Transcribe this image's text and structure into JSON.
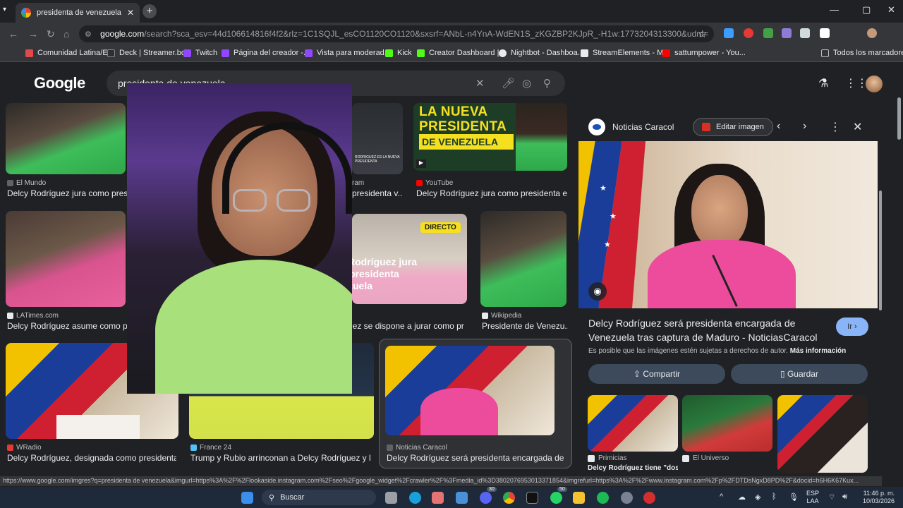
{
  "colors": {
    "accent": "#8ab4f8",
    "background": "#202124",
    "surface": "#303134",
    "text": "#e8eaed"
  },
  "browser": {
    "tab_title": "presidenta de venezuela - Busc",
    "address_host": "google.com",
    "address_rest": "/search?sca_esv=44d106614816f4f2&rlz=1C1SQJL_esCO1120CO1120&sxsrf=ANbL-n4YnA-WdEN1S_zKGZBP2KJpR_-H1w:1773204313300&udm=2&fbs=ADc_l-bpk8W...",
    "bookmarks": [
      {
        "label": "Comunidad Latina/E...",
        "color": "#e04a4a"
      },
      {
        "label": "Deck | Streamer.bot",
        "color": "#2c2f33"
      },
      {
        "label": "Twitch",
        "color": "#9146ff"
      },
      {
        "label": "Página del creador -...",
        "color": "#9146ff"
      },
      {
        "label": "Vista para moderad...",
        "color": "#9146ff"
      },
      {
        "label": "Kick",
        "color": "#53fc18"
      },
      {
        "label": "Creator Dashboard |...",
        "color": "#53fc18"
      },
      {
        "label": "Nightbot - Dashboa...",
        "color": "#e8eaed"
      },
      {
        "label": "StreamElements - M...",
        "color": "#e8eaed"
      },
      {
        "label": "satturnpower - You...",
        "color": "#ff0000"
      }
    ],
    "all_bookmarks": "Todos los marcadores"
  },
  "google": {
    "logo": "Google",
    "query": "presidenta de venezuela"
  },
  "results": [
    {
      "source": "El Mundo",
      "title": "Delcy Rodríguez jura como preside"
    },
    {
      "source": "YouTube",
      "title": "Delcy Rodríguez jura como presidenta en..."
    },
    {
      "source": "LATimes.com",
      "title": "Delcy Rodríguez asume como pres"
    },
    {
      "source": "Wikipedia",
      "title": "Presidente de Venezu..."
    },
    {
      "source": "WRadio",
      "title": "Delcy Rodríguez, designada como presidenta ..."
    },
    {
      "source": "France 24",
      "title": "Trump y Rubio arrinconan a Delcy Rodríguez y la ..."
    },
    {
      "source": "Noticias Caracol",
      "title": "Delcy Rodríguez será presidenta encargada de Ve..."
    },
    {
      "source": "",
      "title": "presidenta v..."
    },
    {
      "source": "",
      "title": "uez se dispone a jurar como pr..."
    }
  ],
  "result_extras": {
    "banner_lines": [
      "LA NUEVA",
      "PRESIDENTA",
      "DE VENEZUELA"
    ],
    "banner_caption": "RODRIGUEZ ES LA NUEVA PRESIDENTA",
    "directo": "DIRECTO",
    "overlay_lines": [
      "Rodríguez jura",
      "presidenta",
      "zuela"
    ],
    "partial_source": "ram"
  },
  "panel": {
    "source": "Noticias Caracol",
    "edit_label": "Editar imagen",
    "title": "Delcy Rodríguez será presidenta encargada de Venezuela tras captura de Maduro - NoticiasCaracol",
    "go_label": "Ir",
    "notice": "Es posible que las imágenes estén sujetas a derechos de autor.",
    "more_info": "Más información",
    "share_label": "Compartir",
    "save_label": "Guardar",
    "related": [
      {
        "source": "Primicias",
        "title": "Delcy Rodríguez tiene \"dos..."
      },
      {
        "source": "El Universo",
        "title": ""
      },
      {
        "source": "",
        "title": ""
      }
    ]
  },
  "status_url": "https://www.google.com/imgres?q=presidenta de venezuela&imgurl=https%3A%2F%2Flookaside.instagram.com%2Fseo%2Fgoogle_widget%2Fcrawler%2F%3Fmedia_id%3D3802076953013371854&imgrefurl=https%3A%2F%2Fwww.instagram.com%2Fp%2FDTDsNgxD8PD%2F&docid=h6H6K67Kux...",
  "taskbar": {
    "search": "Buscar",
    "lang_top": "ESP",
    "lang_bottom": "LAA",
    "time": "11:46 p. m.",
    "date": "10/03/2026",
    "discord_badge": "30",
    "whatsapp_badge": "50"
  }
}
